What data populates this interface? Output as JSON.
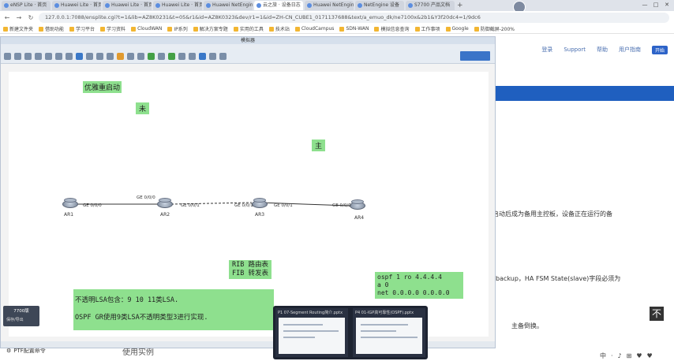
{
  "browser": {
    "tabs": [
      {
        "label": "eNSP Lite · 首页"
      },
      {
        "label": "Huawei Lite · 首页"
      },
      {
        "label": "Huawei Lite · 首页"
      },
      {
        "label": "Huawei Lite · 首页"
      },
      {
        "label": "Huawei NetEngine"
      },
      {
        "label": "云之旅 · 设备日志"
      },
      {
        "label": "Huawei NetEngine"
      },
      {
        "label": "NetEngine 设备"
      },
      {
        "label": "S7700 产品文档"
      }
    ],
    "url": "127.0.0.1:7088/ensplite.cgi?t=1&lib=AZ8K0231&t=05&r1&id=AZ8K0323&dev/r1=1&id=ZH-CN_CUBE1_0171137688&text/a_emuo_dk/ne7100x&2b1&Y3f20dc4=1/9dc6",
    "bookmarks": [
      "新建文件夹",
      "借助功能",
      "学习平台",
      "学习资料",
      "CloudWAN",
      "IP系列",
      "解决方案专题",
      "实用的工具",
      "技术站",
      "CloudCampus",
      "SDN-WAN",
      "模拟信息查询",
      "工作事项",
      "Google",
      "防御截屏-200%"
    ]
  },
  "website": {
    "nav": [
      "登录",
      "Support",
      "帮助",
      "用户指南"
    ],
    "login_button": "开始",
    "text_line_1": "，且启动后成为备用主控板，设备正在运行的备",
    "text_line_2": "backup，HA FSM State(slave)字段必须为",
    "text_line_3": "主备倒换。",
    "use_case": "使用实例",
    "bottom_tab_label": "PTF配置命令",
    "to_top": "不",
    "media_controls": [
      "中",
      "·",
      "♪",
      "⊞",
      "♥",
      "♥"
    ]
  },
  "ensp": {
    "title": "模拟器",
    "mini_panel_title": "7700版",
    "mini_panel_button": "保存/导出"
  },
  "canvas": {
    "notes": {
      "gr_restart": "优雅重启动",
      "standby": "未",
      "master": "主",
      "rib_fib_line1": "RIB  路由表",
      "rib_fib_line2": "FIB  转发表",
      "nssa_line1": "不透明LSA包含：9 10 11类LSA.",
      "nssa_line2": "OSPF GR使用9类LSA不透明类型3进行实现.",
      "ospf_line1": "ospf 1  ro 4.4.4.4",
      "ospf_line2": "a 0",
      "ospf_line3": " net 0.0.0.0 0.0.0.0"
    },
    "routers": [
      {
        "name": "AR1"
      },
      {
        "name": "AR2"
      },
      {
        "name": "AR3"
      },
      {
        "name": "AR4"
      }
    ],
    "interfaces": {
      "ar1_r": "GE 0/0/0",
      "ar2_l": "GE 0/0/0",
      "ar2_r": "GE 0/0/1",
      "ar3_l": "GE 0/0/1",
      "ar3_r": "GE 0/0/1",
      "ar4_l": "GE 0/0/0"
    }
  },
  "taskbar_thumbnails": [
    {
      "title": "P1  07-Segment Routing简介.pptx"
    },
    {
      "title": "P4  01-IGP高可靠性(OSPF).pptx"
    }
  ]
}
